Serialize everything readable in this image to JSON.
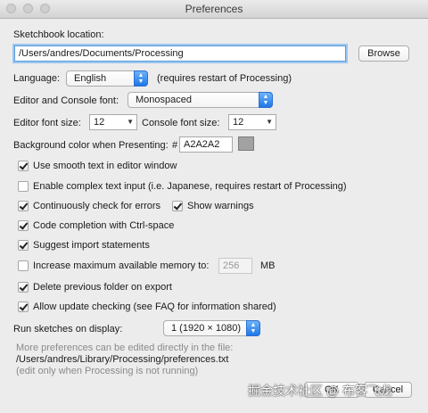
{
  "window": {
    "title": "Preferences"
  },
  "sketchbook": {
    "label": "Sketchbook location:",
    "path": "/Users/andres/Documents/Processing",
    "browse_label": "Browse"
  },
  "language": {
    "label": "Language:",
    "value": "English",
    "note": "(requires restart of Processing)"
  },
  "editor_font": {
    "label": "Editor and Console font:",
    "value": "Monospaced"
  },
  "font_sizes": {
    "editor_label": "Editor font size:",
    "editor_value": "12",
    "console_label": "Console font size:",
    "console_value": "12"
  },
  "background": {
    "label": "Background color when Presenting:",
    "hash": "#",
    "value": "A2A2A2",
    "swatch_color": "#A2A2A2"
  },
  "checkboxes": {
    "smooth": {
      "label": "Use smooth text in editor window",
      "checked": true
    },
    "complex": {
      "label": "Enable complex text input (i.e. Japanese, requires restart of Processing)",
      "checked": false
    },
    "continuous": {
      "label": "Continuously check for errors",
      "checked": true
    },
    "warnings": {
      "label": "Show warnings",
      "checked": true
    },
    "completion": {
      "label": "Code completion with Ctrl-space",
      "checked": true
    },
    "imports": {
      "label": "Suggest import statements",
      "checked": true
    },
    "memory": {
      "label": "Increase maximum available memory to:",
      "checked": false,
      "value": "256",
      "unit": "MB"
    },
    "delete_folder": {
      "label": "Delete previous folder on export",
      "checked": true
    },
    "update_check": {
      "label": "Allow update checking (see FAQ for information shared)",
      "checked": true
    }
  },
  "display": {
    "label": "Run sketches on display:",
    "value": "1 (1920 × 1080)"
  },
  "footer": {
    "more_text": "More preferences can be edited directly in the file:",
    "file_path": "/Users/andres/Library/Processing/preferences.txt",
    "edit_note": "(edit only when Processing is not running)"
  },
  "buttons": {
    "ok_label": "OK",
    "cancel_label": "Cancel"
  },
  "watermark": "掘金技术社区 @ 布客飞龙"
}
